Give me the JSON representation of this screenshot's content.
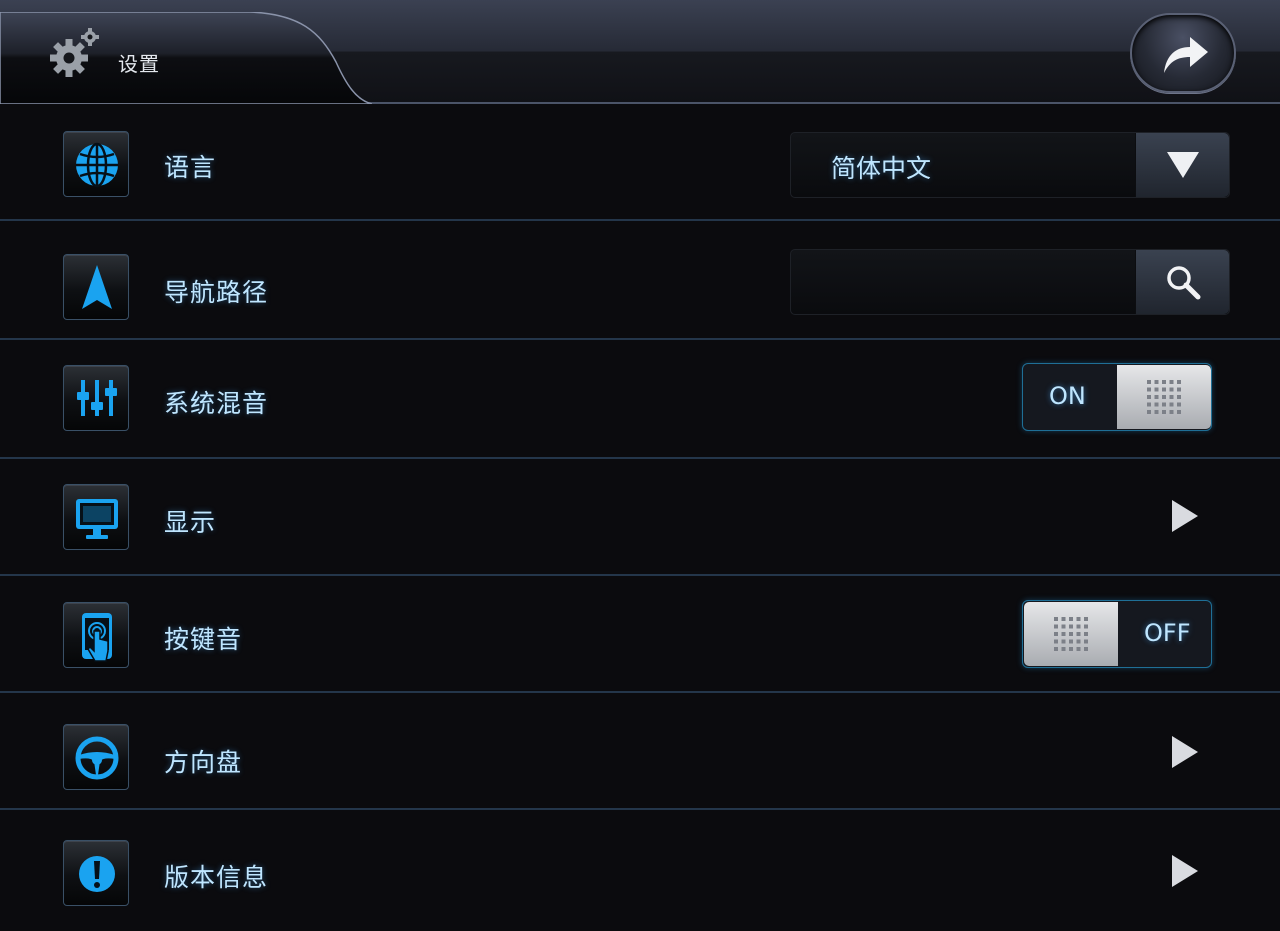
{
  "header": {
    "title": "设置",
    "settings_icon": "gear-icon",
    "back_icon": "arrow-redo-icon"
  },
  "rows": [
    {
      "label": "语言",
      "icon": "globe-icon",
      "control": "select",
      "value": "简体中文"
    },
    {
      "label": "导航路径",
      "icon": "navigation-arrow-icon",
      "control": "search",
      "value": "",
      "placeholder": ""
    },
    {
      "label": "系统混音",
      "icon": "equalizer-icon",
      "control": "toggle",
      "state": "ON"
    },
    {
      "label": "显示",
      "icon": "monitor-icon",
      "control": "chevron"
    },
    {
      "label": "按键音",
      "icon": "touch-phone-icon",
      "control": "toggle",
      "state": "OFF"
    },
    {
      "label": "方向盘",
      "icon": "steering-wheel-icon",
      "control": "chevron"
    },
    {
      "label": "版本信息",
      "icon": "info-exclamation-icon",
      "control": "chevron"
    }
  ],
  "colors": {
    "accent": "#1aa3f0",
    "background": "#0b0b0e",
    "text": "#bfe6ff"
  }
}
